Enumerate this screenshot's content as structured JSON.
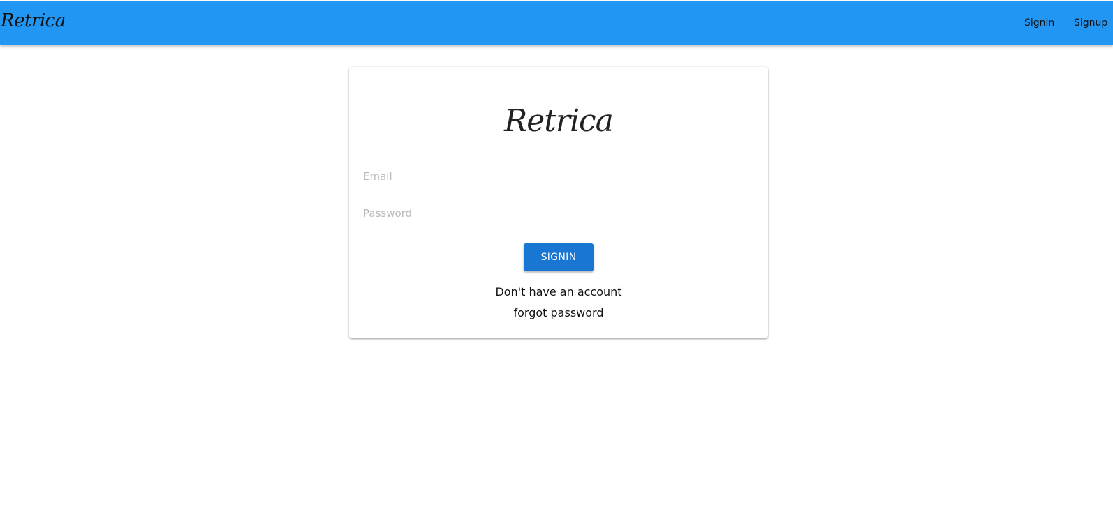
{
  "header": {
    "brand": "Retrica",
    "nav": {
      "signin": "Signin",
      "signup": "Signup"
    }
  },
  "login_card": {
    "logo": "Retrica",
    "email": {
      "placeholder": "Email",
      "value": ""
    },
    "password": {
      "placeholder": "Password",
      "value": ""
    },
    "submit_label": "SIGNIN",
    "signup_link": "Don't have an account",
    "forgot_link": "forgot password"
  },
  "colors": {
    "appbar": "#2196f3",
    "button": "#1976d2"
  }
}
